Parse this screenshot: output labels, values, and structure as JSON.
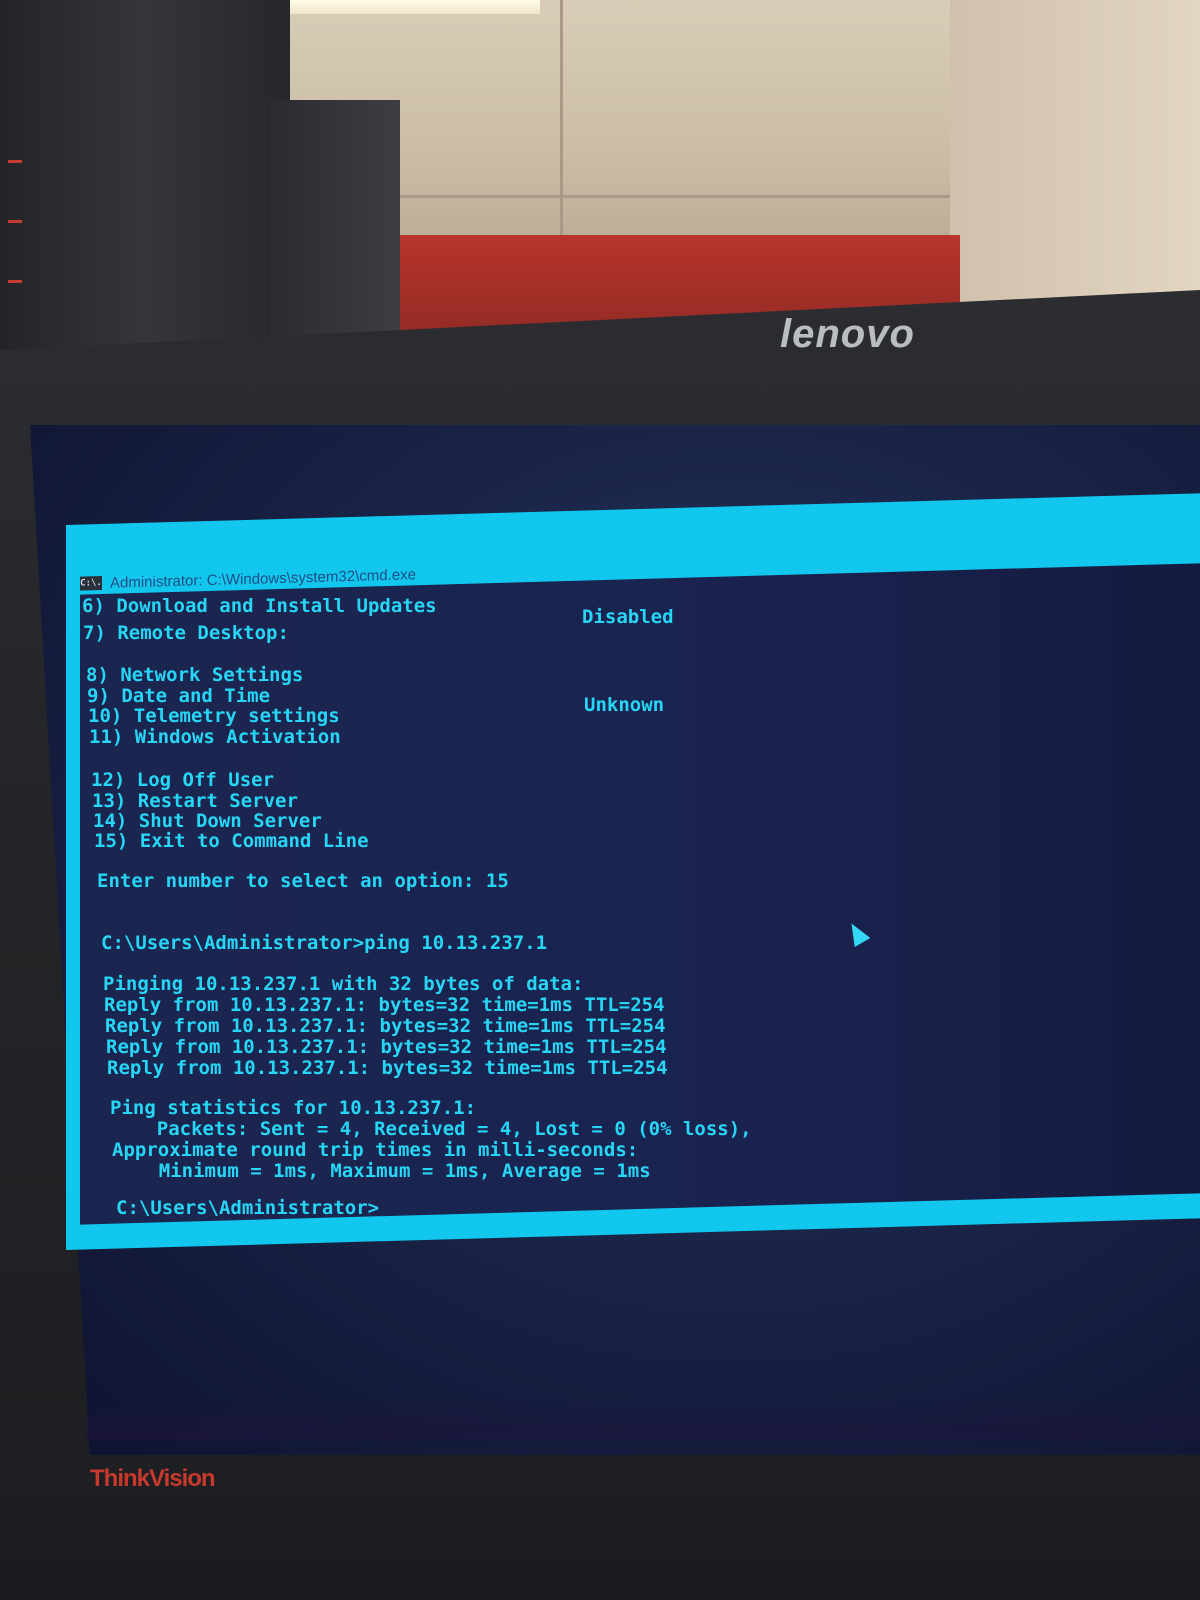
{
  "monitor": {
    "brand_top": "lenovo",
    "brand_bottom": "ThinkVision"
  },
  "window": {
    "title": "Administrator: C:\\Windows\\system32\\cmd.exe",
    "icon": "C:\\."
  },
  "menu": {
    "item6": "6) Download and Install Updates",
    "item6_status": "Disabled",
    "item7": "7) Remote Desktop:",
    "item8": "8) Network Settings",
    "item9": "9) Date and Time",
    "item10": "10) Telemetry settings",
    "item10_status": "Unknown",
    "item11": "11) Windows Activation",
    "item12": "12) Log Off User",
    "item13": "13) Restart Server",
    "item14": "14) Shut Down Server",
    "item15": "15) Exit to Command Line",
    "prompt": "Enter number to select an option: 15"
  },
  "console": {
    "cmd": "C:\\Users\\Administrator>ping 10.13.237.1",
    "pinging": "Pinging 10.13.237.1 with 32 bytes of data:",
    "replies": [
      "Reply from 10.13.237.1: bytes=32 time=1ms TTL=254",
      "Reply from 10.13.237.1: bytes=32 time=1ms TTL=254",
      "Reply from 10.13.237.1: bytes=32 time=1ms TTL=254",
      "Reply from 10.13.237.1: bytes=32 time=1ms TTL=254"
    ],
    "stats_header": "Ping statistics for 10.13.237.1:",
    "packets": "    Packets: Sent = 4, Received = 4, Lost = 0 (0% loss),",
    "rtt_header": "Approximate round trip times in milli-seconds:",
    "rtt_values": "    Minimum = 1ms, Maximum = 1ms, Average = 1ms",
    "final_prompt": "C:\\Users\\Administrator>"
  },
  "colors": {
    "console_text": "#27d6f5",
    "window_frame": "#12c7ee",
    "console_bg": "#1a2350"
  }
}
